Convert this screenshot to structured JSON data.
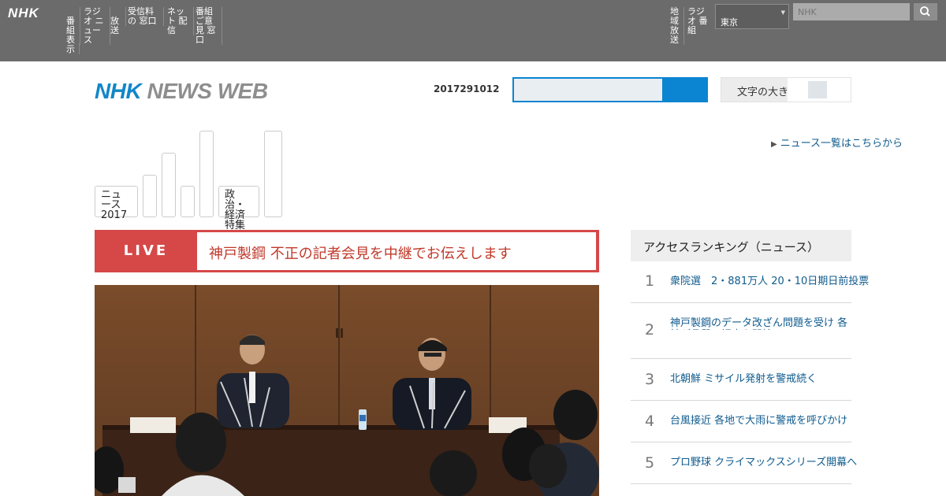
{
  "global_header": {
    "logo": "NHK",
    "nav_items": [
      "番組 表示",
      "ラジオ ニュース",
      "放送",
      "受信料の 窓口",
      "ネット 配信",
      "番組 ご意見 窓口"
    ],
    "right_nav": [
      "地域 放送",
      "ラジオ 番組"
    ],
    "region_value": "東京",
    "search_placeholder": "NHK"
  },
  "header": {
    "logo_nhk": "NHK",
    "logo_rest": " NEWS WEB",
    "date": "2017291012",
    "font_size_label": "文字の大きさ"
  },
  "sub_nav": {
    "first_label": "ニュース 2017",
    "second_label": "政治・経済 特集"
  },
  "side_link": "ニュース一覧はこちらから",
  "live": {
    "label": "LIVE",
    "title": "神戸製鋼 不正の記者会見を中継でお伝えします"
  },
  "ranking": {
    "title": "アクセスランキング（ニュース）",
    "items": [
      {
        "rank": "1",
        "text": "衆院選　2・881万人 20・10日期日前投票"
      },
      {
        "rank": "2",
        "text": "神戸製鋼のデータ改ざん問題を受け 各社が品質の調査を開始"
      },
      {
        "rank": "3",
        "text": "北朝鮮 ミサイル発射を警戒続く"
      },
      {
        "rank": "4",
        "text": "台風接近 各地で大雨に警戒を呼びかけ"
      },
      {
        "rank": "5",
        "text": "プロ野球 クライマックスシリーズ開幕へ"
      }
    ]
  }
}
